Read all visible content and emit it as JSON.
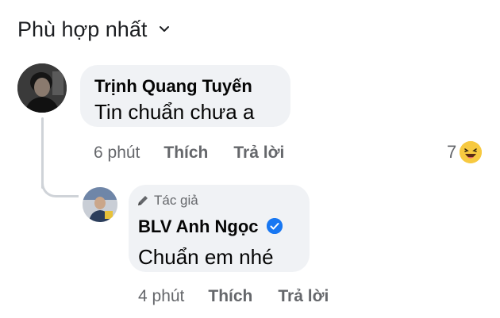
{
  "header": {
    "sort_label": "Phù hợp nhất"
  },
  "comments": [
    {
      "author": "Trịnh Quang Tuyến",
      "text": "Tin chuẩn chưa a",
      "time": "6 phút",
      "like_label": "Thích",
      "reply_label": "Trả lời",
      "reaction_count": "7",
      "reaction_icon": "haha-emoji-icon"
    },
    {
      "author_badge": "Tác giả",
      "author": "BLV Anh Ngọc",
      "verified": true,
      "text": "Chuẩn em nhé",
      "time": "4 phút",
      "like_label": "Thích",
      "reply_label": "Trả lời"
    }
  ],
  "colors": {
    "bubble": "#f0f2f5",
    "meta_text": "#65676b",
    "verified_blue": "#1877f2",
    "reaction_yellow": "#f7c940"
  }
}
